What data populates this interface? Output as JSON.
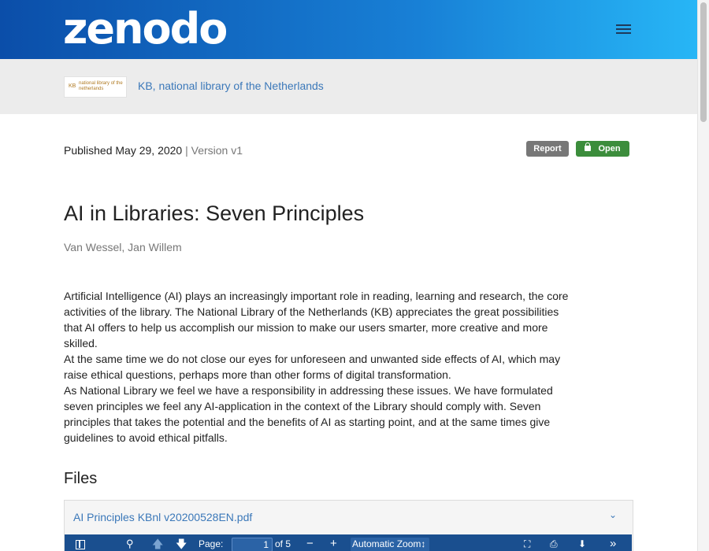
{
  "header": {
    "logo_text": "zenodo",
    "menu_icon": "hamburger-menu-icon",
    "gradient_colors": [
      "#0b4ea9",
      "#27b6f6"
    ]
  },
  "community": {
    "logo_badge": "KB",
    "logo_text": "national library of the netherlands",
    "name": "KB, national library of the Netherlands"
  },
  "record": {
    "published": "Published May 29, 2020",
    "separator": "|",
    "version": "Version v1",
    "report_label": "Report",
    "access_label": "Open",
    "access_icon": "unlock-icon",
    "title": "AI in Libraries: Seven Principles",
    "authors": "Van Wessel, Jan Willem",
    "abstract": [
      "Artificial Intelligence (AI) plays an increasingly important role in reading, learning and research, the core activities of the library. The National Library of the Netherlands (KB) appreciates the great possibilities that AI offers to help us accomplish our mission to make our users smarter, more creative and more skilled.",
      "At the same time we do not close our eyes for unforeseen and unwanted side effects of AI, which may raise ethical questions, perhaps more than other forms of digital transformation.",
      "As National Library we feel we have a responsibility in addressing these issues. We have formulated seven principles we feel any AI-application in the context of the Library should comply with. Seven principles that takes the potential and the benefits of AI as starting point, and at the same times give guidelines to avoid ethical pitfalls."
    ]
  },
  "files": {
    "heading": "Files",
    "file_name": "AI Principles KBnl v20200528EN.pdf",
    "expand_icon": "chevron-down-icon"
  },
  "pdf_viewer": {
    "page_label": "Page:",
    "page_value": "1",
    "page_total": "of 5",
    "zoom_value": "Automatic Zoom",
    "zoom_out": "−",
    "zoom_in": "+"
  },
  "colors": {
    "link": "#3b78b9",
    "open_badge": "#3c8d3c",
    "report_badge": "#777777",
    "pdf_toolbar": "#1a4f8f"
  }
}
